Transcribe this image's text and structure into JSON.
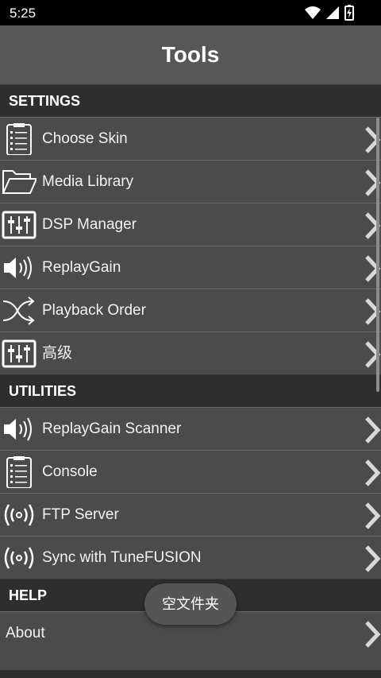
{
  "status_bar": {
    "time": "5:25"
  },
  "header": {
    "title": "Tools"
  },
  "sections": [
    {
      "title": "SETTINGS"
    },
    {
      "title": "UTILITIES"
    },
    {
      "title": "HELP"
    }
  ],
  "settings_items": [
    {
      "label": "Choose Skin",
      "icon": "clipboard-list-icon"
    },
    {
      "label": "Media Library",
      "icon": "folder-open-icon"
    },
    {
      "label": "DSP Manager",
      "icon": "equalizer-sliders-icon"
    },
    {
      "label": "ReplayGain",
      "icon": "speaker-volume-icon"
    },
    {
      "label": "Playback Order",
      "icon": "shuffle-icon"
    },
    {
      "label": "高级",
      "icon": "equalizer-sliders-icon"
    }
  ],
  "utilities_items": [
    {
      "label": "ReplayGain Scanner",
      "icon": "speaker-volume-icon"
    },
    {
      "label": "Console",
      "icon": "clipboard-list-icon"
    },
    {
      "label": "FTP Server",
      "icon": "broadcast-icon"
    },
    {
      "label": "Sync with TuneFUSION",
      "icon": "broadcast-icon"
    }
  ],
  "help_items": [
    {
      "label": "About"
    }
  ],
  "toast": {
    "text": "空文件夹"
  }
}
